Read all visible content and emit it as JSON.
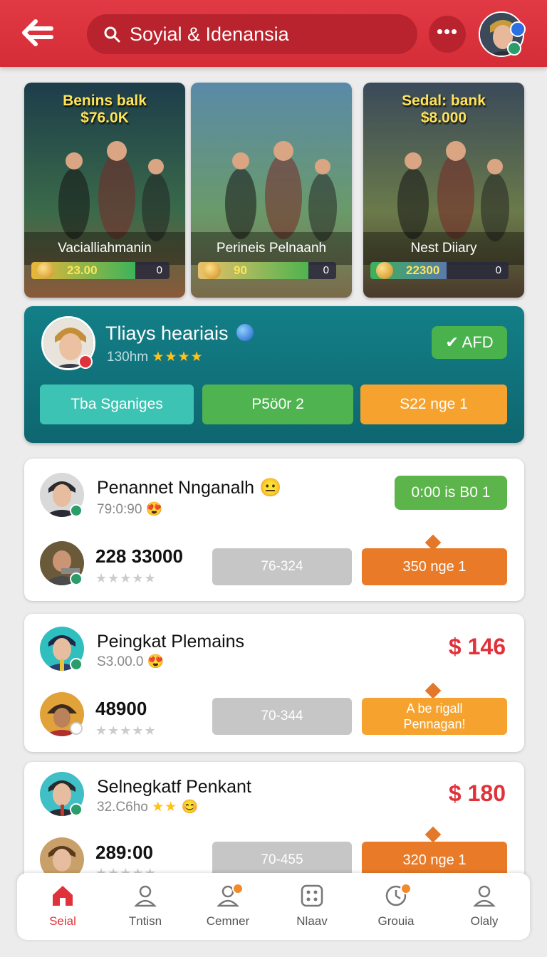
{
  "header": {
    "search_text": "Soyial & Idenansia",
    "more_label": "•••"
  },
  "games": [
    {
      "amount": "Benins balk\n$76.0K",
      "name": "Vacialliahmanin",
      "value": "23.00",
      "end": "0",
      "progress": 0.75
    },
    {
      "amount": "",
      "name": "Perineis Pelnaanh",
      "value": "90",
      "end": "0",
      "progress": 0.8
    },
    {
      "amount": "Sedal: bank\n$8.000",
      "name": "Nest Diiary",
      "value": "22300",
      "end": "0",
      "progress": 0.55
    }
  ],
  "profile": {
    "name": "Tliays heariais",
    "sub": "130hm",
    "stars": "★★★★",
    "afd_label": "AFD",
    "buttons": [
      "Tba Sganiges",
      "P5ö0r 2",
      "S22 nge 1"
    ]
  },
  "matches": [
    {
      "title": "Penannet Nnganalh",
      "sub": "79:0:90",
      "score": "228 33000",
      "stars": "★★★★★",
      "grey": "76-324",
      "action": "350 nge 1",
      "badge": "0:00 is B0 1"
    },
    {
      "title": "Peingkat Plemains",
      "sub": "S3.00.0",
      "score": "48900",
      "stars": "★★★★★",
      "grey": "70-344",
      "action": "A be rigall\nPennagan!",
      "price": "$ 146"
    },
    {
      "title": "Selnegkatf Penkant",
      "sub": "32.C6ho",
      "sub_stars": "★★",
      "score": "289:00",
      "stars": "★★★★★",
      "grey": "70-455",
      "action": "320 nge 1",
      "price": "$ 180"
    }
  ],
  "nav": [
    {
      "label": "Seial",
      "icon": "home-icon",
      "active": true
    },
    {
      "label": "Tntisn",
      "icon": "person-icon"
    },
    {
      "label": "Cemner",
      "icon": "people-icon"
    },
    {
      "label": "Nlaav",
      "icon": "grid-icon"
    },
    {
      "label": "Grouia",
      "icon": "clock-icon"
    },
    {
      "label": "Olaly",
      "icon": "user-icon"
    }
  ],
  "colors": {
    "header_red": "#d42d37",
    "teal": "#0e6670",
    "green": "#49b24d",
    "orange": "#e87a28",
    "price_red": "#e0323a"
  }
}
